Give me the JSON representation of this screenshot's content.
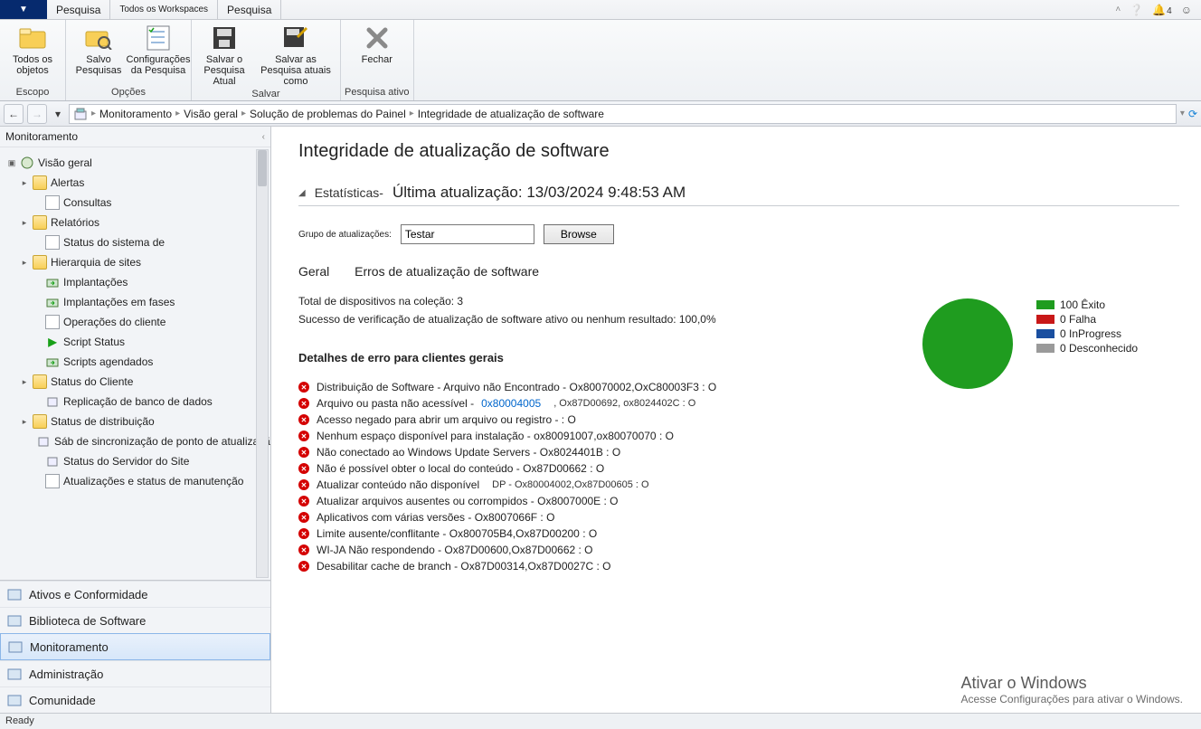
{
  "titlebar": {
    "tabs": [
      "Pesquisa",
      "Todos os Workspaces",
      "Pesquisa"
    ],
    "notifications": "4"
  },
  "ribbon": {
    "groups": [
      {
        "name": "Escopo",
        "items": [
          {
            "label": "Todos os objetos",
            "icon": "folder-icon"
          }
        ]
      },
      {
        "name": "Opções",
        "items": [
          {
            "label": "Salvo Pesquisas",
            "icon": "folder-search-icon"
          },
          {
            "label": "Configurações da Pesquisa",
            "icon": "checklist-icon"
          }
        ]
      },
      {
        "name": "Salvar",
        "items": [
          {
            "label": "Salvar o Pesquisa Atual",
            "icon": "save-icon"
          },
          {
            "label": "Salvar as Pesquisa atuais como",
            "icon": "save-as-icon"
          }
        ]
      },
      {
        "name": "Pesquisa ativo",
        "items": [
          {
            "label": "Fechar",
            "icon": "close-icon"
          }
        ]
      }
    ]
  },
  "breadcrumb": {
    "items": [
      "Monitoramento",
      "Visão geral",
      "Solução de problemas do Painel",
      "Integridade de atualização de software"
    ]
  },
  "sidebar": {
    "title": "Monitoramento",
    "tree": [
      {
        "label": "Visão geral",
        "depth": 0,
        "icon": "globe-icon",
        "exp": "▣"
      },
      {
        "label": "Alertas",
        "depth": 1,
        "icon": "folder-icon",
        "exp": "▸"
      },
      {
        "label": "Consultas",
        "depth": 2,
        "icon": "page-icon",
        "exp": ""
      },
      {
        "label": "Relatórios",
        "depth": 1,
        "icon": "folder-icon",
        "exp": "▸"
      },
      {
        "label": "Status do sistema de",
        "depth": 2,
        "icon": "page-icon",
        "exp": ""
      },
      {
        "label": "Hierarquia de sites",
        "depth": 1,
        "icon": "folder-icon",
        "exp": "▸"
      },
      {
        "label": "Implantações",
        "depth": 2,
        "icon": "deploy-icon",
        "exp": ""
      },
      {
        "label": "Implantações em fases",
        "depth": 2,
        "icon": "deploy-icon",
        "exp": ""
      },
      {
        "label": "Operações do cliente",
        "depth": 2,
        "icon": "page-icon",
        "exp": ""
      },
      {
        "label": "Script Status",
        "depth": 2,
        "icon": "play-icon",
        "exp": ""
      },
      {
        "label": "Scripts agendados",
        "depth": 2,
        "icon": "deploy-icon",
        "exp": ""
      },
      {
        "label": "Status do Cliente",
        "depth": 1,
        "icon": "folder-icon",
        "exp": "▸"
      },
      {
        "label": "Replicação de banco de dados",
        "depth": 2,
        "icon": "db-icon",
        "exp": ""
      },
      {
        "label": "Status de distribuição",
        "depth": 1,
        "icon": "folder-icon",
        "exp": "▸"
      },
      {
        "label": "Sáb de sincronização de ponto de atualização de software",
        "depth": 2,
        "icon": "sync-icon",
        "exp": ""
      },
      {
        "label": "Status do Servidor do Site",
        "depth": 2,
        "icon": "server-icon",
        "exp": ""
      },
      {
        "label": "Atualizações e status de manutenção",
        "depth": 2,
        "icon": "page-icon",
        "exp": ""
      }
    ],
    "wunderbar": [
      {
        "label": "Ativos e Conformidade",
        "icon": "assets-icon"
      },
      {
        "label": "Biblioteca de Software",
        "icon": "library-icon"
      },
      {
        "label": "Monitoramento",
        "icon": "monitor-icon",
        "selected": true
      },
      {
        "label": "Administração",
        "icon": "admin-icon"
      },
      {
        "label": "Comunidade",
        "icon": "community-icon"
      }
    ]
  },
  "content": {
    "title": "Integridade de atualização de software",
    "stats_label": "Estatísticas-",
    "last_update_label": "Última atualização:",
    "last_update_value": "13/03/2024 9:48:53 AM",
    "group_label": "Grupo de atualizações:",
    "group_value": "Testar",
    "browse": "Browse",
    "tab_general": "Geral",
    "tab_errors": "Erros de atualização de software",
    "total_devices": "Total de dispositivos na coleção: 3",
    "success_line": "Sucesso de verificação de atualização de software ativo ou nenhum resultado: 100,0%",
    "errors_title": "Detalhes de erro para clientes gerais",
    "errors": [
      {
        "text": "Distribuição de Software - Arquivo não Encontrado - Ox80070002,OxC80003F3 : O"
      },
      {
        "text": "Arquivo ou pasta não acessível - ",
        "link": "0x80004005",
        "extra": ", Ox87D00692, ox8024402C : O"
      },
      {
        "text": "Acesso negado para abrir um arquivo ou registro - : O"
      },
      {
        "text": "Nenhum espaço disponível para instalação - ox80091007,ox80070070 : O"
      },
      {
        "text": "Não conectado ao Windows Update Servers - Ox8024401B : O"
      },
      {
        "text": "Não é possível obter o local do conteúdo - Ox87D00662 : O"
      },
      {
        "text": "Atualizar conteúdo não disponível",
        "extra": "DP - Ox80004002,Ox87D00605 : O"
      },
      {
        "text": "Atualizar arquivos ausentes ou corrompidos - Ox8007000E : O"
      },
      {
        "text": "Aplicativos com várias versões - Ox8007066F : O"
      },
      {
        "text": "Limite ausente/conflitante - Ox800705B4,Ox87D00200 : O"
      },
      {
        "text": "WI-JA Não respondendo - Ox87D00600,Ox87D00662 : O"
      },
      {
        "text": "Desabilitar cache de branch - Ox87D00314,Ox87D0027C : O"
      }
    ],
    "watermark_title": "Ativar o Windows",
    "watermark_sub": "Acesse Configurações para ativar o Windows."
  },
  "chart_data": {
    "type": "pie",
    "title": "",
    "series": [
      {
        "name": "Êxito",
        "value": 100,
        "color": "#1f9c1f"
      },
      {
        "name": "Falha",
        "value": 0,
        "color": "#c81818"
      },
      {
        "name": "InProgress",
        "value": 0,
        "color": "#1a4fa0"
      },
      {
        "name": "Desconhecido",
        "value": 0,
        "color": "#9a9a9a"
      }
    ]
  },
  "statusbar": {
    "text": "Ready"
  }
}
